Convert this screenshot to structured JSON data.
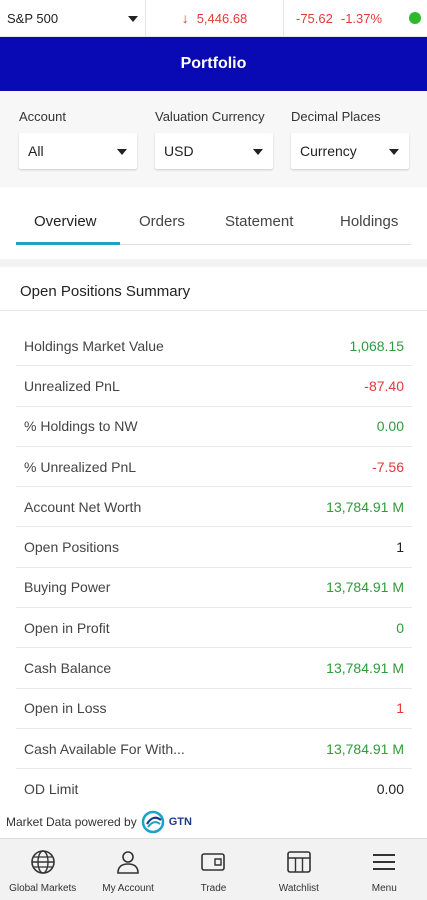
{
  "ticker": {
    "index_name": "S&P 500",
    "price": "5,446.68",
    "change": "-75.62",
    "change_pct": "-1.37%",
    "down_color": "#e53935",
    "status_color": "#2eb82e"
  },
  "header": {
    "title": "Portfolio",
    "bg_color": "#0a0ab4"
  },
  "filters": [
    {
      "label": "Account",
      "value": "All"
    },
    {
      "label": "Valuation Currency",
      "value": "USD"
    },
    {
      "label": "Decimal Places",
      "value": "Currency"
    }
  ],
  "tabs": [
    {
      "label": "Overview",
      "active": true
    },
    {
      "label": "Orders",
      "active": false
    },
    {
      "label": "Statement",
      "active": false
    },
    {
      "label": "Holdings",
      "active": false
    }
  ],
  "summary": {
    "title": "Open Positions Summary",
    "rows": [
      {
        "label": "Holdings Market Value",
        "value": "1,068.15",
        "tone": "green"
      },
      {
        "label": "Unrealized PnL",
        "value": "-87.40",
        "tone": "red"
      },
      {
        "label": "% Holdings to NW",
        "value": "0.00",
        "tone": "green"
      },
      {
        "label": "% Unrealized PnL",
        "value": "-7.56",
        "tone": "red"
      },
      {
        "label": "Account Net Worth",
        "value": "13,784.91 M",
        "tone": "green"
      },
      {
        "label": "Open Positions",
        "value": "1",
        "tone": "dark"
      },
      {
        "label": "Buying Power",
        "value": "13,784.91 M",
        "tone": "green"
      },
      {
        "label": "Open in Profit",
        "value": "0",
        "tone": "green"
      },
      {
        "label": "Cash Balance",
        "value": "13,784.91 M",
        "tone": "green"
      },
      {
        "label": "Open in Loss",
        "value": "1",
        "tone": "red"
      },
      {
        "label": "Cash Available For With...",
        "value": "13,784.91 M",
        "tone": "green"
      },
      {
        "label": "OD Limit",
        "value": "0.00",
        "tone": "dark"
      }
    ]
  },
  "footer": {
    "powered_text": "Market Data powered by",
    "logo_text": "GTN"
  },
  "bottom_nav": [
    {
      "label": "Global Markets",
      "icon": "globe-icon"
    },
    {
      "label": "My Account",
      "icon": "user-icon"
    },
    {
      "label": "Trade",
      "icon": "wallet-icon"
    },
    {
      "label": "Watchlist",
      "icon": "watchlist-icon"
    },
    {
      "label": "Menu",
      "icon": "menu-icon"
    }
  ]
}
